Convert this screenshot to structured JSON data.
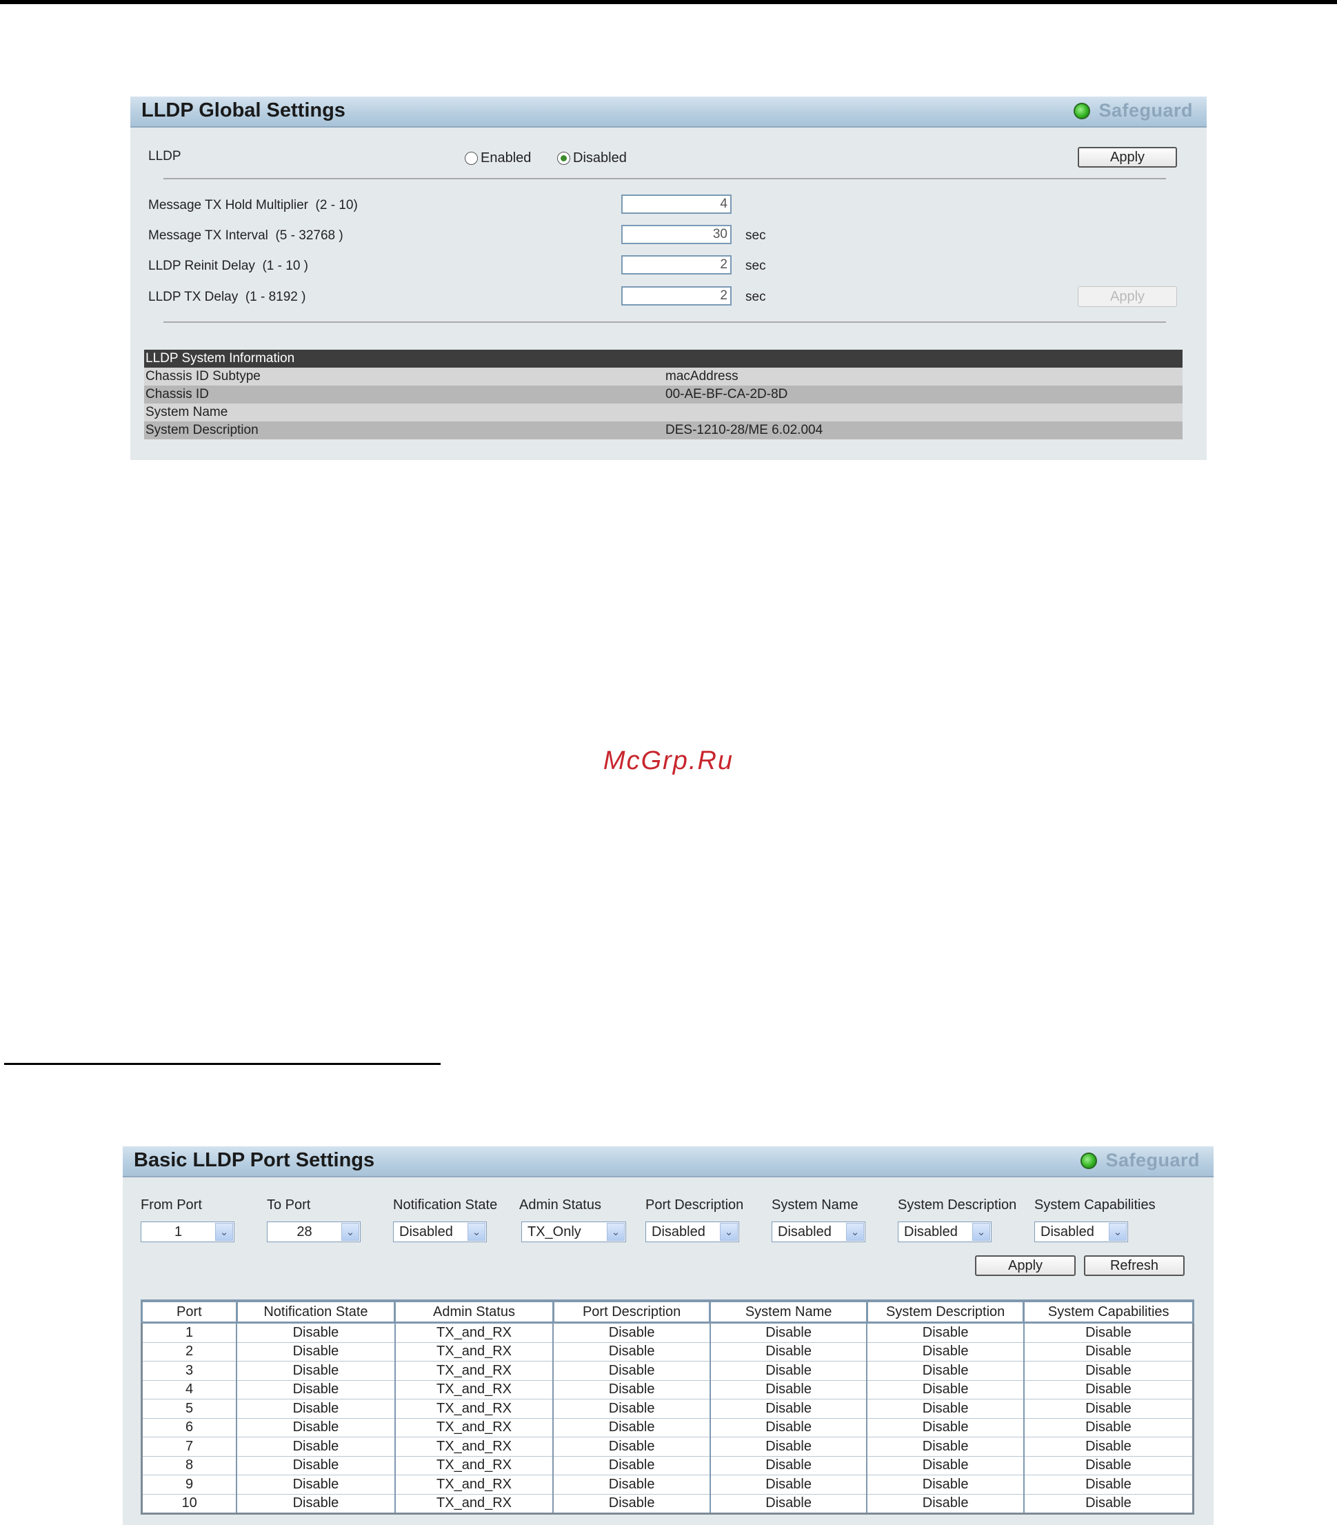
{
  "global": {
    "title": "LLDP Global Settings",
    "safeguard": "Safeguard",
    "lldp_label": "LLDP",
    "enabled_label": "Enabled",
    "disabled_label": "Disabled",
    "lldp_state": "Disabled",
    "apply_label": "Apply",
    "fields": [
      {
        "label": "Message TX Hold Multiplier",
        "range": "(2 - 10)",
        "value": "4",
        "unit": ""
      },
      {
        "label": "Message TX Interval",
        "range": "(5 - 32768 )",
        "value": "30",
        "unit": "sec"
      },
      {
        "label": "LLDP Reinit Delay",
        "range": "(1 - 10 )",
        "value": "2",
        "unit": "sec"
      },
      {
        "label": "LLDP TX Delay",
        "range": "(1 - 8192 )",
        "value": "2",
        "unit": "sec"
      }
    ],
    "apply2_label": "Apply",
    "system_info": {
      "header": "LLDP System Information",
      "rows": [
        {
          "name": "Chassis ID Subtype",
          "value": "macAddress"
        },
        {
          "name": "Chassis ID",
          "value": "00-AE-BF-CA-2D-8D"
        },
        {
          "name": "System Name",
          "value": ""
        },
        {
          "name": "System Description",
          "value": "DES-1210-28/ME 6.02.004"
        }
      ]
    }
  },
  "watermark": "McGrp.Ru",
  "port": {
    "title": "Basic LLDP Port Settings",
    "safeguard": "Safeguard",
    "controls": {
      "from_port": {
        "label": "From Port",
        "value": "1"
      },
      "to_port": {
        "label": "To Port",
        "value": "28"
      },
      "notification_state": {
        "label": "Notification State",
        "value": "Disabled"
      },
      "admin_status": {
        "label": "Admin Status",
        "value": "TX_Only"
      },
      "port_description": {
        "label": "Port Description",
        "value": "Disabled"
      },
      "system_name": {
        "label": "System Name",
        "value": "Disabled"
      },
      "system_description": {
        "label": "System Description",
        "value": "Disabled"
      },
      "system_capabilities": {
        "label": "System Capabilities",
        "value": "Disabled"
      }
    },
    "apply_label": "Apply",
    "refresh_label": "Refresh",
    "table": {
      "headers": [
        "Port",
        "Notification State",
        "Admin Status",
        "Port Description",
        "System Name",
        "System Description",
        "System Capabilities"
      ],
      "rows": [
        [
          "1",
          "Disable",
          "TX_and_RX",
          "Disable",
          "Disable",
          "Disable",
          "Disable"
        ],
        [
          "2",
          "Disable",
          "TX_and_RX",
          "Disable",
          "Disable",
          "Disable",
          "Disable"
        ],
        [
          "3",
          "Disable",
          "TX_and_RX",
          "Disable",
          "Disable",
          "Disable",
          "Disable"
        ],
        [
          "4",
          "Disable",
          "TX_and_RX",
          "Disable",
          "Disable",
          "Disable",
          "Disable"
        ],
        [
          "5",
          "Disable",
          "TX_and_RX",
          "Disable",
          "Disable",
          "Disable",
          "Disable"
        ],
        [
          "6",
          "Disable",
          "TX_and_RX",
          "Disable",
          "Disable",
          "Disable",
          "Disable"
        ],
        [
          "7",
          "Disable",
          "TX_and_RX",
          "Disable",
          "Disable",
          "Disable",
          "Disable"
        ],
        [
          "8",
          "Disable",
          "TX_and_RX",
          "Disable",
          "Disable",
          "Disable",
          "Disable"
        ],
        [
          "9",
          "Disable",
          "TX_and_RX",
          "Disable",
          "Disable",
          "Disable",
          "Disable"
        ],
        [
          "10",
          "Disable",
          "TX_and_RX",
          "Disable",
          "Disable",
          "Disable",
          "Disable"
        ]
      ]
    }
  }
}
